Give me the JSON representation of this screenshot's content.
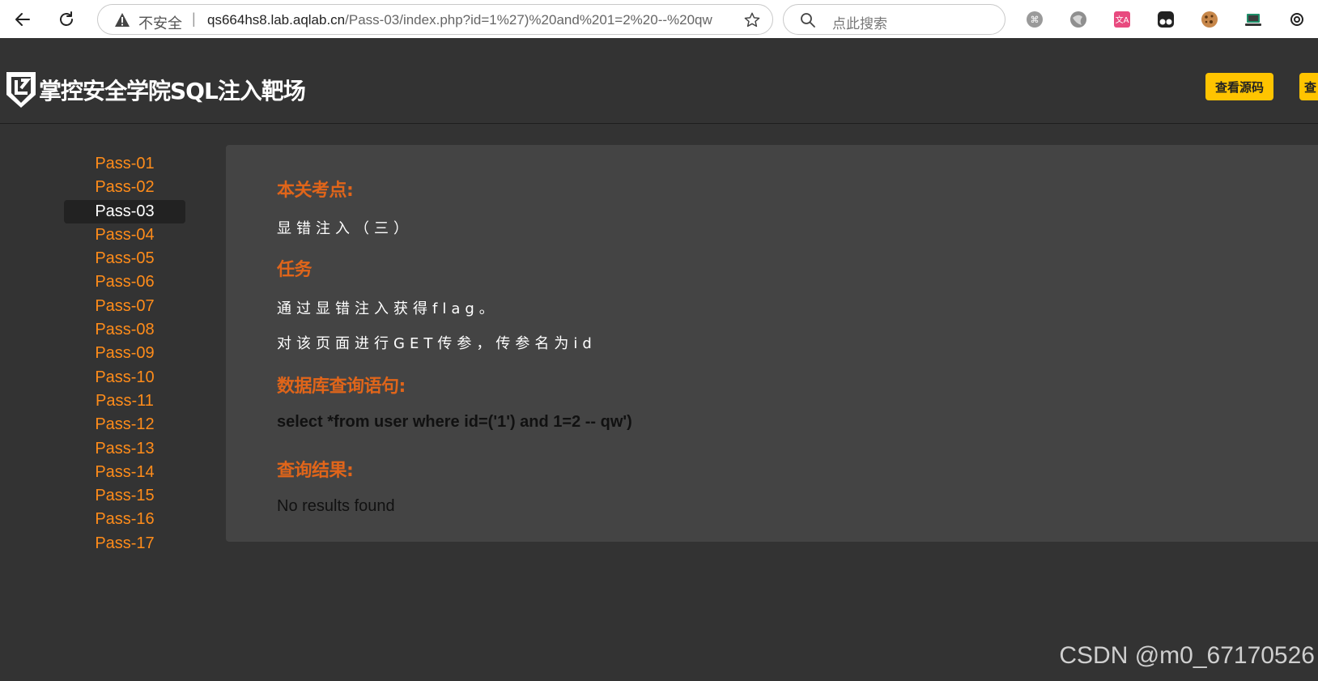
{
  "browser": {
    "insecure_label": "不安全",
    "separator": "|",
    "url_host": "qs664hs8.lab.aqlab.cn",
    "url_path": "/Pass-03/index.php?id=1%27)%20and%201=2%20--%20qw",
    "search_placeholder": "点此搜索"
  },
  "header": {
    "title": "掌控安全学院SQL注入靶场",
    "buttons": [
      "查看源码",
      "查"
    ],
    "accent_color": "#ffc400"
  },
  "sidebar": {
    "items": [
      "Pass-01",
      "Pass-02",
      "Pass-03",
      "Pass-04",
      "Pass-05",
      "Pass-06",
      "Pass-07",
      "Pass-08",
      "Pass-09",
      "Pass-10",
      "Pass-11",
      "Pass-12",
      "Pass-13",
      "Pass-14",
      "Pass-15",
      "Pass-16",
      "Pass-17"
    ],
    "active": "Pass-03",
    "link_color": "#ff8c1a"
  },
  "main": {
    "focus_title": "本关考点:",
    "focus_text": "显错注入（三）",
    "task_title": "任务",
    "task_line1": "通过显错注入获得flag。",
    "task_line2": "对该页面进行GET传参，传参名为id",
    "query_title": "数据库查询语句:",
    "query": "select *from user where id=('1') and 1=2 -- qw')",
    "result_title": "查询结果:",
    "result": "No results found",
    "title_color": "#e0651a"
  },
  "watermark": "CSDN @m0_67170526"
}
